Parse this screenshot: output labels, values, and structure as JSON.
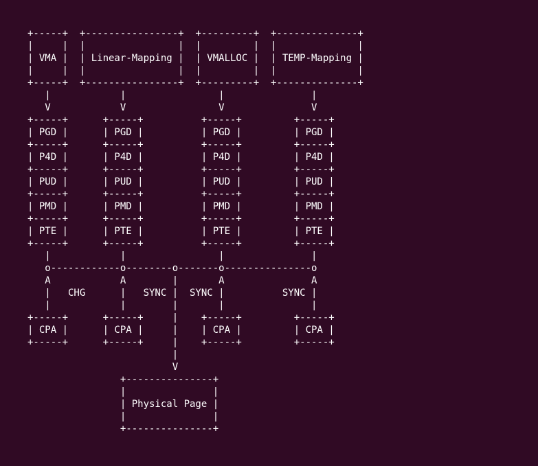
{
  "diagram": {
    "headers": [
      "VMA",
      "Linear-Mapping",
      "VMALLOC",
      "TEMP-Mapping"
    ],
    "pagetable_levels": [
      "PGD",
      "P4D",
      "PUD",
      "PMD",
      "PTE"
    ],
    "edge_labels": [
      "CHG",
      "SYNC",
      "SYNC",
      "SYNC"
    ],
    "bottom_boxes": [
      "CPA",
      "CPA",
      "CPA",
      "CPA"
    ],
    "final_box": "Physical Page"
  },
  "ascii": {
    "l01": "+-----+  +----------------+  +---------+  +--------------+",
    "l02": "|     |  |                |  |         |  |              |",
    "l03": "| VMA |  | Linear-Mapping |  | VMALLOC |  | TEMP-Mapping |",
    "l04": "|     |  |                |  |         |  |              |",
    "l05": "+-----+  +----------------+  +---------+  +--------------+",
    "l06": "   |            |                |               |",
    "l07": "   V            V                V               V",
    "l08": "+-----+      +-----+          +-----+         +-----+",
    "l09": "| PGD |      | PGD |          | PGD |         | PGD |",
    "l10": "+-----+      +-----+          +-----+         +-----+",
    "l11": "| P4D |      | P4D |          | P4D |         | P4D |",
    "l12": "+-----+      +-----+          +-----+         +-----+",
    "l13": "| PUD |      | PUD |          | PUD |         | PUD |",
    "l14": "+-----+      +-----+          +-----+         +-----+",
    "l15": "| PMD |      | PMD |          | PMD |         | PMD |",
    "l16": "+-----+      +-----+          +-----+         +-----+",
    "l17": "| PTE |      | PTE |          | PTE |         | PTE |",
    "l18": "+-----+      +-----+          +-----+         +-----+",
    "l19": "   |            |                |               |",
    "l20": "   o------------o--------o-------o---------------o",
    "l21": "   A            A        |       A               A",
    "l22": "   |   CHG      |   SYNC |  SYNC |          SYNC |",
    "l23": "   |            |        |       |               |",
    "l24": "+-----+      +-----+     |    +-----+         +-----+",
    "l25": "| CPA |      | CPA |     |    | CPA |         | CPA |",
    "l26": "+-----+      +-----+     |    +-----+         +-----+",
    "l27": "                         |",
    "l28": "                         V",
    "l29": "                +---------------+",
    "l30": "                |               |",
    "l31": "                | Physical Page |",
    "l32": "                |               |",
    "l33": "                +---------------+"
  }
}
